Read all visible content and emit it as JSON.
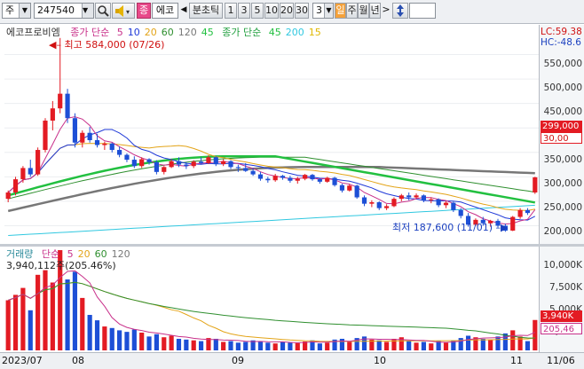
{
  "toolbar": {
    "market": "주",
    "code": "247540",
    "search_icon": "magnifier-icon",
    "speaker_icon": "speaker-icon",
    "eco_prefix": "종",
    "eco_name": "에코",
    "prev_arrow": "◀",
    "period_mode": "분초틱",
    "intervals": [
      "1",
      "3",
      "5",
      "10",
      "20",
      "30"
    ],
    "count": "3",
    "tf_day": "일",
    "tf_week": "주",
    "tf_month": "월",
    "tf_year": "년",
    "next_arrow": ">",
    "updown_icon": "up-down-arrow-icon"
  },
  "price_panel": {
    "title": "에코프로비엠",
    "legend1_prefix": "종가 단순",
    "legend1": [
      {
        "label": "5",
        "color": "#c8308a"
      },
      {
        "label": "10",
        "color": "#1f39d8"
      },
      {
        "label": "20",
        "color": "#e3a418"
      },
      {
        "label": "60",
        "color": "#2f8f2f"
      },
      {
        "label": "120",
        "color": "#777777"
      },
      {
        "label": "45",
        "color": "#22c040"
      }
    ],
    "legend2_prefix": "종가 단순",
    "legend2": [
      {
        "label": "45",
        "color": "#22c040"
      },
      {
        "label": "200",
        "color": "#30c8e0"
      },
      {
        "label": "15",
        "color": "#e0b800"
      }
    ],
    "lc_text": "LC:59.38",
    "hc_text": "HC:-48.6",
    "high_note": "최고 584,000 (07/26)",
    "low_note": "최저 187,600 (11/01)",
    "current_price_tag": "299,000",
    "ticks": [
      "550,000",
      "500,000",
      "450,000",
      "400,000",
      "350,000",
      "300,000",
      "250,000",
      "200,000"
    ],
    "ma_tag": "30,00"
  },
  "volume_panel": {
    "title": "거래량",
    "legend_prefix": "단순",
    "legend": [
      {
        "label": "5",
        "color": "#c8308a"
      },
      {
        "label": "20",
        "color": "#e3a418"
      },
      {
        "label": "60",
        "color": "#2f8f2f"
      },
      {
        "label": "120",
        "color": "#777777"
      }
    ],
    "info": "3,940,112주(205.46%)",
    "ticks": [
      "10,000K",
      "7,500K",
      "5,000K",
      "2,500K"
    ],
    "volume_tag": "3,940K",
    "ma_tag": "205,46"
  },
  "date_axis": {
    "labels": [
      "2023/07",
      "08",
      "09",
      "10",
      "11",
      "11/06"
    ]
  },
  "colors": {
    "up": "#e31b23",
    "down": "#1d4fd6"
  },
  "chart_data": {
    "type": "candlestick",
    "price_range": [
      170000,
      600000
    ],
    "volume_unit": "K shares",
    "candles": [
      {
        "o": 255000,
        "h": 272000,
        "l": 248000,
        "c": 268000,
        "v": 6500
      },
      {
        "o": 268000,
        "h": 300000,
        "l": 262000,
        "c": 295000,
        "v": 7200
      },
      {
        "o": 295000,
        "h": 322000,
        "l": 288000,
        "c": 318000,
        "v": 8100
      },
      {
        "o": 318000,
        "h": 335000,
        "l": 300000,
        "c": 305000,
        "v": 5200
      },
      {
        "o": 305000,
        "h": 360000,
        "l": 302000,
        "c": 355000,
        "v": 9800
      },
      {
        "o": 355000,
        "h": 420000,
        "l": 350000,
        "c": 415000,
        "v": 10400
      },
      {
        "o": 415000,
        "h": 455000,
        "l": 395000,
        "c": 440000,
        "v": 8800
      },
      {
        "o": 440000,
        "h": 584000,
        "l": 430000,
        "c": 470000,
        "v": 13000
      },
      {
        "o": 470000,
        "h": 480000,
        "l": 410000,
        "c": 420000,
        "v": 9200
      },
      {
        "o": 420000,
        "h": 430000,
        "l": 360000,
        "c": 370000,
        "v": 10200
      },
      {
        "o": 370000,
        "h": 395000,
        "l": 360000,
        "c": 390000,
        "v": 6800
      },
      {
        "o": 390000,
        "h": 402000,
        "l": 370000,
        "c": 375000,
        "v": 4600
      },
      {
        "o": 375000,
        "h": 388000,
        "l": 360000,
        "c": 365000,
        "v": 3900
      },
      {
        "o": 365000,
        "h": 372000,
        "l": 355000,
        "c": 368000,
        "v": 3100
      },
      {
        "o": 368000,
        "h": 370000,
        "l": 350000,
        "c": 355000,
        "v": 2900
      },
      {
        "o": 355000,
        "h": 362000,
        "l": 340000,
        "c": 345000,
        "v": 2600
      },
      {
        "o": 345000,
        "h": 348000,
        "l": 330000,
        "c": 335000,
        "v": 2400
      },
      {
        "o": 335000,
        "h": 342000,
        "l": 318000,
        "c": 322000,
        "v": 2700
      },
      {
        "o": 322000,
        "h": 340000,
        "l": 318000,
        "c": 336000,
        "v": 2300
      },
      {
        "o": 336000,
        "h": 338000,
        "l": 325000,
        "c": 330000,
        "v": 1800
      },
      {
        "o": 330000,
        "h": 334000,
        "l": 305000,
        "c": 310000,
        "v": 2100
      },
      {
        "o": 310000,
        "h": 322000,
        "l": 305000,
        "c": 320000,
        "v": 1700
      },
      {
        "o": 320000,
        "h": 336000,
        "l": 318000,
        "c": 332000,
        "v": 1900
      },
      {
        "o": 332000,
        "h": 340000,
        "l": 320000,
        "c": 325000,
        "v": 1500
      },
      {
        "o": 325000,
        "h": 330000,
        "l": 316000,
        "c": 322000,
        "v": 1400
      },
      {
        "o": 322000,
        "h": 334000,
        "l": 318000,
        "c": 331000,
        "v": 1300
      },
      {
        "o": 331000,
        "h": 340000,
        "l": 325000,
        "c": 328000,
        "v": 1200
      },
      {
        "o": 328000,
        "h": 344000,
        "l": 326000,
        "c": 340000,
        "v": 1600
      },
      {
        "o": 340000,
        "h": 342000,
        "l": 322000,
        "c": 326000,
        "v": 1500
      },
      {
        "o": 326000,
        "h": 336000,
        "l": 322000,
        "c": 332000,
        "v": 1100
      },
      {
        "o": 332000,
        "h": 334000,
        "l": 316000,
        "c": 320000,
        "v": 1200
      },
      {
        "o": 320000,
        "h": 325000,
        "l": 310000,
        "c": 318000,
        "v": 1000
      },
      {
        "o": 318000,
        "h": 328000,
        "l": 310000,
        "c": 312000,
        "v": 1100
      },
      {
        "o": 312000,
        "h": 318000,
        "l": 302000,
        "c": 305000,
        "v": 1300
      },
      {
        "o": 305000,
        "h": 310000,
        "l": 292000,
        "c": 296000,
        "v": 1200
      },
      {
        "o": 296000,
        "h": 300000,
        "l": 288000,
        "c": 293000,
        "v": 1000
      },
      {
        "o": 293000,
        "h": 306000,
        "l": 290000,
        "c": 302000,
        "v": 900
      },
      {
        "o": 302000,
        "h": 304000,
        "l": 294000,
        "c": 298000,
        "v": 1100
      },
      {
        "o": 298000,
        "h": 302000,
        "l": 288000,
        "c": 292000,
        "v": 1000
      },
      {
        "o": 292000,
        "h": 300000,
        "l": 286000,
        "c": 296000,
        "v": 950
      },
      {
        "o": 296000,
        "h": 306000,
        "l": 293000,
        "c": 304000,
        "v": 1150
      },
      {
        "o": 304000,
        "h": 306000,
        "l": 292000,
        "c": 295000,
        "v": 1300
      },
      {
        "o": 295000,
        "h": 298000,
        "l": 286000,
        "c": 290000,
        "v": 900
      },
      {
        "o": 290000,
        "h": 300000,
        "l": 288000,
        "c": 298000,
        "v": 1000
      },
      {
        "o": 298000,
        "h": 300000,
        "l": 280000,
        "c": 283000,
        "v": 1400
      },
      {
        "o": 283000,
        "h": 286000,
        "l": 268000,
        "c": 272000,
        "v": 1500
      },
      {
        "o": 272000,
        "h": 285000,
        "l": 270000,
        "c": 282000,
        "v": 1100
      },
      {
        "o": 282000,
        "h": 284000,
        "l": 255000,
        "c": 258000,
        "v": 1600
      },
      {
        "o": 258000,
        "h": 262000,
        "l": 240000,
        "c": 245000,
        "v": 1800
      },
      {
        "o": 245000,
        "h": 252000,
        "l": 238000,
        "c": 248000,
        "v": 1400
      },
      {
        "o": 248000,
        "h": 250000,
        "l": 232000,
        "c": 236000,
        "v": 1300
      },
      {
        "o": 236000,
        "h": 244000,
        "l": 232000,
        "c": 240000,
        "v": 1100
      },
      {
        "o": 240000,
        "h": 258000,
        "l": 238000,
        "c": 255000,
        "v": 1500
      },
      {
        "o": 255000,
        "h": 265000,
        "l": 250000,
        "c": 262000,
        "v": 1700
      },
      {
        "o": 262000,
        "h": 268000,
        "l": 252000,
        "c": 258000,
        "v": 1200
      },
      {
        "o": 258000,
        "h": 266000,
        "l": 255000,
        "c": 262000,
        "v": 1000
      },
      {
        "o": 262000,
        "h": 264000,
        "l": 248000,
        "c": 252000,
        "v": 1100
      },
      {
        "o": 252000,
        "h": 258000,
        "l": 246000,
        "c": 254000,
        "v": 900
      },
      {
        "o": 254000,
        "h": 256000,
        "l": 238000,
        "c": 242000,
        "v": 1200
      },
      {
        "o": 242000,
        "h": 250000,
        "l": 236000,
        "c": 247000,
        "v": 1000
      },
      {
        "o": 247000,
        "h": 249000,
        "l": 228000,
        "c": 232000,
        "v": 1300
      },
      {
        "o": 232000,
        "h": 236000,
        "l": 215000,
        "c": 220000,
        "v": 1600
      },
      {
        "o": 220000,
        "h": 226000,
        "l": 198000,
        "c": 202000,
        "v": 1900
      },
      {
        "o": 202000,
        "h": 215000,
        "l": 200000,
        "c": 212000,
        "v": 1700
      },
      {
        "o": 212000,
        "h": 218000,
        "l": 200000,
        "c": 205000,
        "v": 1500
      },
      {
        "o": 205000,
        "h": 212000,
        "l": 198000,
        "c": 210000,
        "v": 1400
      },
      {
        "o": 210000,
        "h": 214000,
        "l": 196000,
        "c": 200000,
        "v": 1800
      },
      {
        "o": 200000,
        "h": 204000,
        "l": 187600,
        "c": 190000,
        "v": 2200
      },
      {
        "o": 190000,
        "h": 220000,
        "l": 189000,
        "c": 218000,
        "v": 2600
      },
      {
        "o": 218000,
        "h": 236000,
        "l": 214000,
        "c": 232000,
        "v": 1800
      },
      {
        "o": 232000,
        "h": 236000,
        "l": 222000,
        "c": 226000,
        "v": 1200
      },
      {
        "o": 268000,
        "h": 300000,
        "l": 265000,
        "c": 299000,
        "v": 3940
      }
    ]
  }
}
